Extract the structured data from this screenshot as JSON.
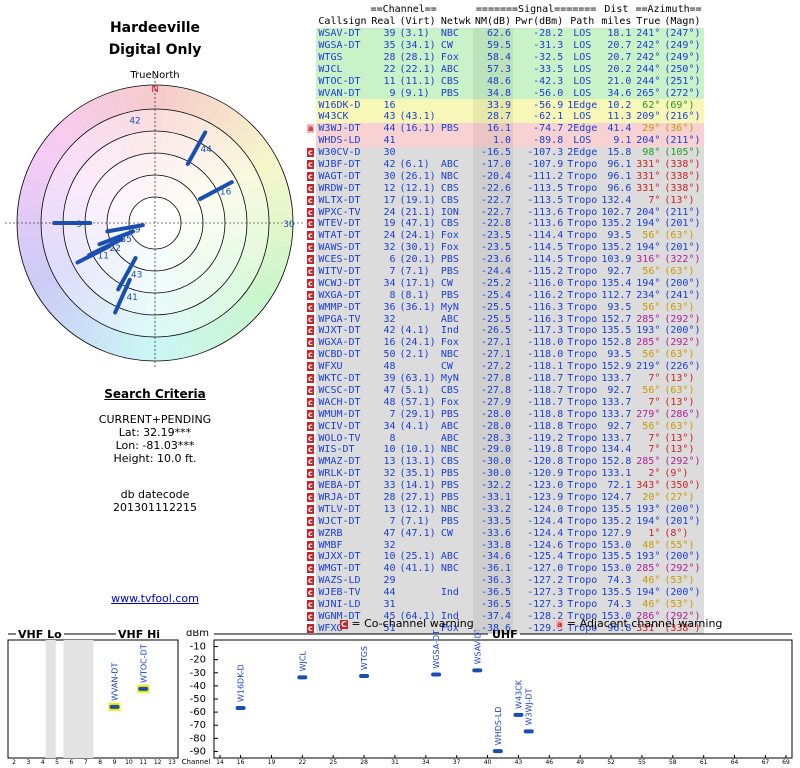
{
  "title": "Hardeeville",
  "subtitle": "Digital Only",
  "radar": {
    "true_north_label": "TrueNorth",
    "north_label": "N",
    "markers": [
      {
        "label": "42",
        "azimuth": 344,
        "radius": 0.78
      },
      {
        "label": "44",
        "azimuth": 29,
        "radius": 0.62
      },
      {
        "label": "16",
        "azimuth": 62,
        "radius": 0.5
      },
      {
        "label": "30",
        "azimuth": 90,
        "radius": 0.9
      },
      {
        "label": "9",
        "azimuth": 270,
        "radius": 0.6
      },
      {
        "label": "39",
        "azimuth": 260,
        "radius": 0.22
      },
      {
        "label": "35",
        "azimuth": 249,
        "radius": 0.3
      },
      {
        "label": "22",
        "azimuth": 244,
        "radius": 0.4
      },
      {
        "label": "11",
        "azimuth": 243,
        "radius": 0.5
      },
      {
        "label": "43",
        "azimuth": 209,
        "radius": 0.42
      },
      {
        "label": "41",
        "azimuth": 204,
        "radius": 0.58
      }
    ]
  },
  "search_criteria": {
    "heading": "Search Criteria",
    "mode": "CURRENT+PENDING",
    "lat": "Lat: 32.19***",
    "lon": "Lon: -81.03***",
    "height": "Height: 10.0 ft."
  },
  "db": {
    "label": "db datecode",
    "value": "201301112215"
  },
  "link": "www.tvfool.com",
  "table": {
    "group_headers": {
      "channel": "==Channel==",
      "signal": "=======Signal=======",
      "dist": "Dist",
      "azimuth": "==Azimuth=="
    },
    "columns": [
      "Callsign",
      "Real",
      "(Virt)",
      "Netwk",
      "NM(dB)",
      "Pwr(dBm)",
      "Path",
      "miles",
      "True",
      "(Magn)"
    ],
    "rows": [
      {
        "w": "",
        "call": "WSAV-DT",
        "real": "39",
        "virt": "(3.1)",
        "net": "NBC",
        "nm": "62.6",
        "pwr": "-28.2",
        "path": "LOS",
        "dist": "18.1",
        "true": "241°",
        "magn": "(247°)"
      },
      {
        "w": "",
        "call": "WGSA-DT",
        "real": "35",
        "virt": "(34.1)",
        "net": "CW",
        "nm": "59.5",
        "pwr": "-31.3",
        "path": "LOS",
        "dist": "20.7",
        "true": "242°",
        "magn": "(249°)"
      },
      {
        "w": "",
        "call": "WTGS",
        "real": "28",
        "virt": "(28.1)",
        "net": "Fox",
        "nm": "58.4",
        "pwr": "-32.5",
        "path": "LOS",
        "dist": "20.7",
        "true": "242°",
        "magn": "(249°)"
      },
      {
        "w": "",
        "call": "WJCL",
        "real": "22",
        "virt": "(22.1)",
        "net": "ABC",
        "nm": "57.3",
        "pwr": "-33.5",
        "path": "LOS",
        "dist": "20.2",
        "true": "244°",
        "magn": "(250°)"
      },
      {
        "w": "",
        "call": "WTOC-DT",
        "real": "11",
        "virt": "(11.1)",
        "net": "CBS",
        "nm": "48.6",
        "pwr": "-42.3",
        "path": "LOS",
        "dist": "21.0",
        "true": "244°",
        "magn": "(251°)"
      },
      {
        "w": "",
        "call": "WVAN-DT",
        "real": "9",
        "virt": "(9.1)",
        "net": "PBS",
        "nm": "34.8",
        "pwr": "-56.0",
        "path": "LOS",
        "dist": "34.6",
        "true": "265°",
        "magn": "(272°)"
      },
      {
        "w": "",
        "call": "W16DK-D",
        "real": "16",
        "virt": "",
        "net": "",
        "nm": "33.9",
        "pwr": "-56.9",
        "path": "1Edge",
        "dist": "10.2",
        "true": "62°",
        "magn": "(69°)"
      },
      {
        "w": "",
        "call": "W43CK",
        "real": "43",
        "virt": "(43.1)",
        "net": "",
        "nm": "28.7",
        "pwr": "-62.1",
        "path": "LOS",
        "dist": "11.3",
        "true": "209°",
        "magn": "(216°)"
      },
      {
        "w": "a",
        "call": "W3WJ-DT",
        "real": "44",
        "virt": "(16.1)",
        "net": "PBS",
        "nm": "16.1",
        "pwr": "-74.7",
        "path": "2Edge",
        "dist": "41.4",
        "true": "29°",
        "magn": "(36°)"
      },
      {
        "w": "",
        "call": "WHDS-LD",
        "real": "41",
        "virt": "",
        "net": "",
        "nm": "1.0",
        "pwr": "-89.8",
        "path": "LOS",
        "dist": "9.1",
        "true": "204°",
        "magn": "(211°)"
      },
      {
        "w": "c",
        "call": "W30CV-D",
        "real": "30",
        "virt": "",
        "net": "",
        "nm": "-16.5",
        "pwr": "-107.3",
        "path": "2Edge",
        "dist": "15.8",
        "true": "98°",
        "magn": "(105°)"
      },
      {
        "w": "c",
        "call": "WJBF-DT",
        "real": "42",
        "virt": "(6.1)",
        "net": "ABC",
        "nm": "-17.0",
        "pwr": "-107.9",
        "path": "Tropo",
        "dist": "96.1",
        "true": "331°",
        "magn": "(338°)"
      },
      {
        "w": "c",
        "call": "WAGT-DT",
        "real": "30",
        "virt": "(26.1)",
        "net": "NBC",
        "nm": "-20.4",
        "pwr": "-111.2",
        "path": "Tropo",
        "dist": "96.1",
        "true": "331°",
        "magn": "(338°)"
      },
      {
        "w": "c",
        "call": "WRDW-DT",
        "real": "12",
        "virt": "(12.1)",
        "net": "CBS",
        "nm": "-22.6",
        "pwr": "-113.5",
        "path": "Tropo",
        "dist": "96.6",
        "true": "331°",
        "magn": "(338°)"
      },
      {
        "w": "c",
        "call": "WLTX-DT",
        "real": "17",
        "virt": "(19.1)",
        "net": "CBS",
        "nm": "-22.7",
        "pwr": "-113.5",
        "path": "Tropo",
        "dist": "132.4",
        "true": "7°",
        "magn": "(13°)"
      },
      {
        "w": "c",
        "call": "WPXC-TV",
        "real": "24",
        "virt": "(21.1)",
        "net": "ION",
        "nm": "-22.7",
        "pwr": "-113.6",
        "path": "Tropo",
        "dist": "102.7",
        "true": "204°",
        "magn": "(211°)"
      },
      {
        "w": "c",
        "call": "WTEV-DT",
        "real": "19",
        "virt": "(47.1)",
        "net": "CBS",
        "nm": "-22.8",
        "pwr": "-113.6",
        "path": "Tropo",
        "dist": "135.2",
        "true": "194°",
        "magn": "(201°)"
      },
      {
        "w": "c",
        "call": "WTAT-DT",
        "real": "24",
        "virt": "(24.1)",
        "net": "Fox",
        "nm": "-23.5",
        "pwr": "-114.4",
        "path": "Tropo",
        "dist": "93.5",
        "true": "56°",
        "magn": "(63°)"
      },
      {
        "w": "c",
        "call": "WAWS-DT",
        "real": "32",
        "virt": "(30.1)",
        "net": "Fox",
        "nm": "-23.5",
        "pwr": "-114.5",
        "path": "Tropo",
        "dist": "135.2",
        "true": "194°",
        "magn": "(201°)"
      },
      {
        "w": "c",
        "call": "WCES-DT",
        "real": "6",
        "virt": "(20.1)",
        "net": "PBS",
        "nm": "-23.6",
        "pwr": "-114.5",
        "path": "Tropo",
        "dist": "103.9",
        "true": "316°",
        "magn": "(322°)"
      },
      {
        "w": "c",
        "call": "WITV-DT",
        "real": "7",
        "virt": "(7.1)",
        "net": "PBS",
        "nm": "-24.4",
        "pwr": "-115.2",
        "path": "Tropo",
        "dist": "92.7",
        "true": "56°",
        "magn": "(63°)"
      },
      {
        "w": "c",
        "call": "WCWJ-DT",
        "real": "34",
        "virt": "(17.1)",
        "net": "CW",
        "nm": "-25.2",
        "pwr": "-116.0",
        "path": "Tropo",
        "dist": "135.4",
        "true": "194°",
        "magn": "(200°)"
      },
      {
        "w": "c",
        "call": "WXGA-DT",
        "real": "8",
        "virt": "(8.1)",
        "net": "PBS",
        "nm": "-25.4",
        "pwr": "-116.2",
        "path": "Tropo",
        "dist": "112.7",
        "true": "234°",
        "magn": "(241°)"
      },
      {
        "w": "c",
        "call": "WMMP-DT",
        "real": "36",
        "virt": "(36.1)",
        "net": "MyN",
        "nm": "-25.5",
        "pwr": "-116.3",
        "path": "Tropo",
        "dist": "93.5",
        "true": "56°",
        "magn": "(63°)"
      },
      {
        "w": "c",
        "call": "WPGA-TV",
        "real": "32",
        "virt": "",
        "net": "ABC",
        "nm": "-25.5",
        "pwr": "-116.3",
        "path": "Tropo",
        "dist": "152.7",
        "true": "285°",
        "magn": "(292°)"
      },
      {
        "w": "c",
        "call": "WJXT-DT",
        "real": "42",
        "virt": "(4.1)",
        "net": "Ind",
        "nm": "-26.5",
        "pwr": "-117.3",
        "path": "Tropo",
        "dist": "135.5",
        "true": "193°",
        "magn": "(200°)"
      },
      {
        "w": "c",
        "call": "WGXA-DT",
        "real": "16",
        "virt": "(24.1)",
        "net": "Fox",
        "nm": "-27.1",
        "pwr": "-118.0",
        "path": "Tropo",
        "dist": "152.8",
        "true": "285°",
        "magn": "(292°)"
      },
      {
        "w": "c",
        "call": "WCBD-DT",
        "real": "50",
        "virt": "(2.1)",
        "net": "NBC",
        "nm": "-27.1",
        "pwr": "-118.0",
        "path": "Tropo",
        "dist": "93.5",
        "true": "56°",
        "magn": "(63°)"
      },
      {
        "w": "c",
        "call": "WFXU",
        "real": "48",
        "virt": "",
        "net": "CW",
        "nm": "-27.2",
        "pwr": "-118.1",
        "path": "Tropo",
        "dist": "152.9",
        "true": "219°",
        "magn": "(226°)"
      },
      {
        "w": "c",
        "call": "WKTC-DT",
        "real": "39",
        "virt": "(63.1)",
        "net": "MyN",
        "nm": "-27.8",
        "pwr": "-118.7",
        "path": "Tropo",
        "dist": "133.7",
        "true": "7°",
        "magn": "(13°)"
      },
      {
        "w": "c",
        "call": "WCSC-DT",
        "real": "47",
        "virt": "(5.1)",
        "net": "CBS",
        "nm": "-27.8",
        "pwr": "-118.7",
        "path": "Tropo",
        "dist": "92.7",
        "true": "56°",
        "magn": "(63°)"
      },
      {
        "w": "c",
        "call": "WACH-DT",
        "real": "48",
        "virt": "(57.1)",
        "net": "Fox",
        "nm": "-27.9",
        "pwr": "-118.7",
        "path": "Tropo",
        "dist": "133.7",
        "true": "7°",
        "magn": "(13°)"
      },
      {
        "w": "c",
        "call": "WMUM-DT",
        "real": "7",
        "virt": "(29.1)",
        "net": "PBS",
        "nm": "-28.0",
        "pwr": "-118.8",
        "path": "Tropo",
        "dist": "133.7",
        "true": "279°",
        "magn": "(286°)"
      },
      {
        "w": "c",
        "call": "WCIV-DT",
        "real": "34",
        "virt": "(4.1)",
        "net": "ABC",
        "nm": "-28.0",
        "pwr": "-118.8",
        "path": "Tropo",
        "dist": "92.7",
        "true": "56°",
        "magn": "(63°)"
      },
      {
        "w": "c",
        "call": "WOLO-TV",
        "real": "8",
        "virt": "",
        "net": "ABC",
        "nm": "-28.3",
        "pwr": "-119.2",
        "path": "Tropo",
        "dist": "133.7",
        "true": "7°",
        "magn": "(13°)"
      },
      {
        "w": "c",
        "call": "WIS-DT",
        "real": "10",
        "virt": "(10.1)",
        "net": "NBC",
        "nm": "-29.0",
        "pwr": "-119.8",
        "path": "Tropo",
        "dist": "134.4",
        "true": "7°",
        "magn": "(13°)"
      },
      {
        "w": "c",
        "call": "WMAZ-DT",
        "real": "13",
        "virt": "(13.1)",
        "net": "CBS",
        "nm": "-30.0",
        "pwr": "-120.8",
        "path": "Tropo",
        "dist": "152.8",
        "true": "285°",
        "magn": "(292°)"
      },
      {
        "w": "c",
        "call": "WRLK-DT",
        "real": "32",
        "virt": "(35.1)",
        "net": "PBS",
        "nm": "-30.0",
        "pwr": "-120.9",
        "path": "Tropo",
        "dist": "133.1",
        "true": "2°",
        "magn": "(9°)"
      },
      {
        "w": "c",
        "call": "WEBA-DT",
        "real": "33",
        "virt": "(14.1)",
        "net": "PBS",
        "nm": "-32.2",
        "pwr": "-123.0",
        "path": "Tropo",
        "dist": "72.1",
        "true": "343°",
        "magn": "(350°)"
      },
      {
        "w": "c",
        "call": "WRJA-DT",
        "real": "28",
        "virt": "(27.1)",
        "net": "PBS",
        "nm": "-33.1",
        "pwr": "-123.9",
        "path": "Tropo",
        "dist": "124.7",
        "true": "20°",
        "magn": "(27°)"
      },
      {
        "w": "c",
        "call": "WTLV-DT",
        "real": "13",
        "virt": "(12.1)",
        "net": "NBC",
        "nm": "-33.2",
        "pwr": "-124.0",
        "path": "Tropo",
        "dist": "135.5",
        "true": "193°",
        "magn": "(200°)"
      },
      {
        "w": "c",
        "call": "WJCT-DT",
        "real": "7",
        "virt": "(7.1)",
        "net": "PBS",
        "nm": "-33.5",
        "pwr": "-124.4",
        "path": "Tropo",
        "dist": "135.2",
        "true": "194°",
        "magn": "(201°)"
      },
      {
        "w": "c",
        "call": "WZRB",
        "real": "47",
        "virt": "(47.1)",
        "net": "CW",
        "nm": "-33.6",
        "pwr": "-124.4",
        "path": "Tropo",
        "dist": "127.9",
        "true": "1°",
        "magn": "(8°)"
      },
      {
        "w": "c",
        "call": "WMBF",
        "real": "32",
        "virt": "",
        "net": "",
        "nm": "-33.8",
        "pwr": "-124.6",
        "path": "Tropo",
        "dist": "153.0",
        "true": "48°",
        "magn": "(55°)"
      },
      {
        "w": "c",
        "call": "WJXX-DT",
        "real": "10",
        "virt": "(25.1)",
        "net": "ABC",
        "nm": "-34.6",
        "pwr": "-125.4",
        "path": "Tropo",
        "dist": "135.5",
        "true": "193°",
        "magn": "(200°)"
      },
      {
        "w": "c",
        "call": "WMGT-DT",
        "real": "40",
        "virt": "(41.1)",
        "net": "NBC",
        "nm": "-36.1",
        "pwr": "-127.0",
        "path": "Tropo",
        "dist": "153.0",
        "true": "285°",
        "magn": "(292°)"
      },
      {
        "w": "c",
        "call": "WAZS-LD",
        "real": "29",
        "virt": "",
        "net": "",
        "nm": "-36.3",
        "pwr": "-127.2",
        "path": "Tropo",
        "dist": "74.3",
        "true": "46°",
        "magn": "(53°)"
      },
      {
        "w": "c",
        "call": "WJEB-TV",
        "real": "44",
        "virt": "",
        "net": "Ind",
        "nm": "-36.5",
        "pwr": "-127.3",
        "path": "Tropo",
        "dist": "135.5",
        "true": "194°",
        "magn": "(200°)"
      },
      {
        "w": "c",
        "call": "WJNI-LD",
        "real": "31",
        "virt": "",
        "net": "",
        "nm": "-36.5",
        "pwr": "-127.3",
        "path": "Tropo",
        "dist": "74.3",
        "true": "46°",
        "magn": "(53°)"
      },
      {
        "w": "c",
        "call": "WGNM-DT",
        "real": "45",
        "virt": "(64.1)",
        "net": "Ind",
        "nm": "-37.4",
        "pwr": "-128.2",
        "path": "Tropo",
        "dist": "153.0",
        "true": "286°",
        "magn": "(292°)"
      },
      {
        "w": "c",
        "call": "WFXG",
        "real": "51",
        "virt": "",
        "net": "Fox",
        "nm": "-38.6",
        "pwr": "-129.5",
        "path": "Tropo",
        "dist": "96.8",
        "true": "331°",
        "magn": "(338°)"
      }
    ]
  },
  "legend": {
    "co_icon": "C",
    "co_text": "= Co-channel warning",
    "adj_icon": "a",
    "adj_text": "= Adjacent channel warning"
  },
  "chart_data": {
    "type": "bar",
    "panels": {
      "vhf_lo": "VHF Lo",
      "vhf_hi": "VHF Hi",
      "uhf": "UHF"
    },
    "ylabel": "dBm",
    "ylim": [
      -95,
      -5
    ],
    "yticks": [
      -10,
      -20,
      -30,
      -40,
      -50,
      -60,
      -70,
      -80,
      -90
    ],
    "xlabel": "Channel",
    "vhf_x_ticks": [
      "2",
      "3",
      "4",
      "5",
      "6",
      "7",
      "8",
      "9",
      "10",
      "11",
      "12",
      "13"
    ],
    "uhf_x_ticks": [
      "14",
      "16",
      "19",
      "22",
      "25",
      "28",
      "31",
      "34",
      "37",
      "40",
      "43",
      "46",
      "49",
      "52",
      "55",
      "58",
      "61",
      "64",
      "67",
      "69"
    ],
    "points": [
      {
        "label": "WVAN-DT",
        "channel": 9,
        "dbm": -56.0,
        "band": "vhf"
      },
      {
        "label": "WTOC-DT",
        "channel": 11,
        "dbm": -42.3,
        "band": "vhf"
      },
      {
        "label": "W16DK-D",
        "channel": 16,
        "dbm": -56.9,
        "band": "uhf"
      },
      {
        "label": "WJCL",
        "channel": 22,
        "dbm": -33.5,
        "band": "uhf"
      },
      {
        "label": "WTGS",
        "channel": 28,
        "dbm": -32.5,
        "band": "uhf"
      },
      {
        "label": "WGSA-DT",
        "channel": 35,
        "dbm": -31.3,
        "band": "uhf"
      },
      {
        "label": "WSAV-DT",
        "channel": 39,
        "dbm": -28.2,
        "band": "uhf"
      },
      {
        "label": "WHDS-LD",
        "channel": 41,
        "dbm": -89.8,
        "band": "uhf"
      },
      {
        "label": "W43CK",
        "channel": 43,
        "dbm": -62.1,
        "band": "uhf"
      },
      {
        "label": "W3WJ-DT",
        "channel": 44,
        "dbm": -74.7,
        "band": "uhf"
      }
    ]
  },
  "colors": {
    "green_row": "#c9f2c9",
    "yellow_row": "#f7f7b8",
    "grey_row": "#dcdcdc",
    "pink_row": "#f8d2d2",
    "callsign": "#1b3fd0",
    "warn": "#c8242a",
    "bar": "#1a4fb0",
    "highlight": "#f0f000"
  }
}
